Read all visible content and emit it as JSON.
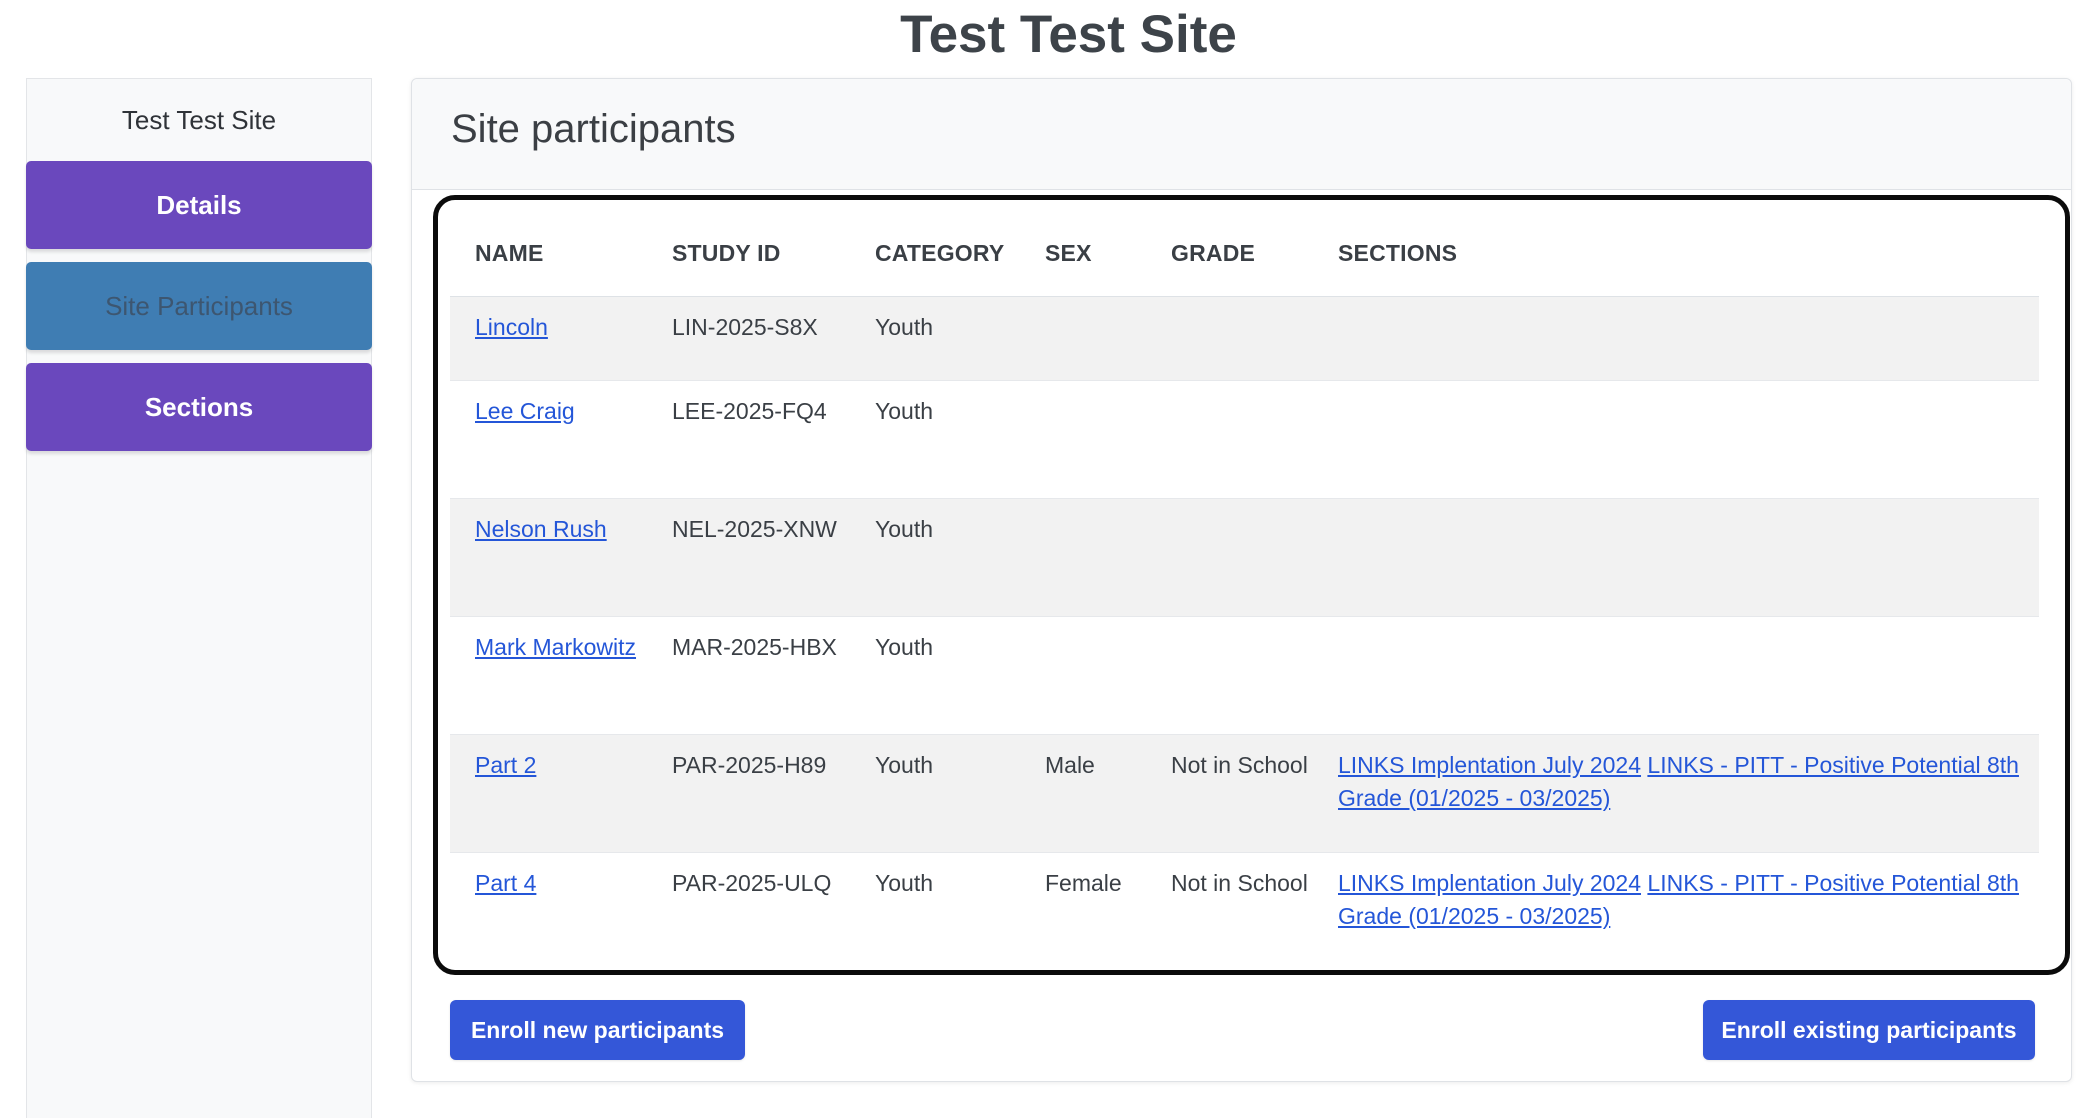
{
  "page": {
    "title": "Test Test Site"
  },
  "sidebar": {
    "title": "Test Test Site",
    "items": [
      {
        "label": "Details"
      },
      {
        "label": "Site Participants",
        "active": true
      },
      {
        "label": "Sections"
      }
    ]
  },
  "main": {
    "header": "Site participants",
    "table": {
      "columns": [
        "NAME",
        "STUDY ID",
        "CATEGORY",
        "SEX",
        "GRADE",
        "SECTIONS"
      ],
      "rows": [
        {
          "name": "Lincoln",
          "study_id": "LIN-2025-S8X",
          "category": "Youth",
          "sex": "",
          "grade": "",
          "sections": []
        },
        {
          "name": "Lee Craig",
          "study_id": "LEE-2025-FQ4",
          "category": "Youth",
          "sex": "",
          "grade": "",
          "sections": []
        },
        {
          "name": "Nelson Rush",
          "study_id": "NEL-2025-XNW",
          "category": "Youth",
          "sex": "",
          "grade": "",
          "sections": []
        },
        {
          "name": "Mark Markowitz",
          "study_id": "MAR-2025-HBX",
          "category": "Youth",
          "sex": "",
          "grade": "",
          "sections": []
        },
        {
          "name": "Part 2",
          "study_id": "PAR-2025-H89",
          "category": "Youth",
          "sex": "Male",
          "grade": "Not in School",
          "sections": [
            "LINKS Implentation July 2024",
            "LINKS - PITT - Positive Potential 8th Grade (01/2025 - 03/2025)"
          ]
        },
        {
          "name": "Part 4",
          "study_id": "PAR-2025-ULQ",
          "category": "Youth",
          "sex": "Female",
          "grade": "Not in School",
          "sections": [
            "LINKS Implentation July 2024",
            "LINKS - PITT - Positive Potential 8th Grade (01/2025 - 03/2025)"
          ]
        }
      ]
    },
    "buttons": {
      "enroll_new": "Enroll new participants",
      "enroll_existing": "Enroll existing participants"
    }
  },
  "colors": {
    "sidebar_button": "#6a48bd",
    "sidebar_button_active": "#3f7db3",
    "primary_button": "#3457d8",
    "link": "#2456d8"
  }
}
